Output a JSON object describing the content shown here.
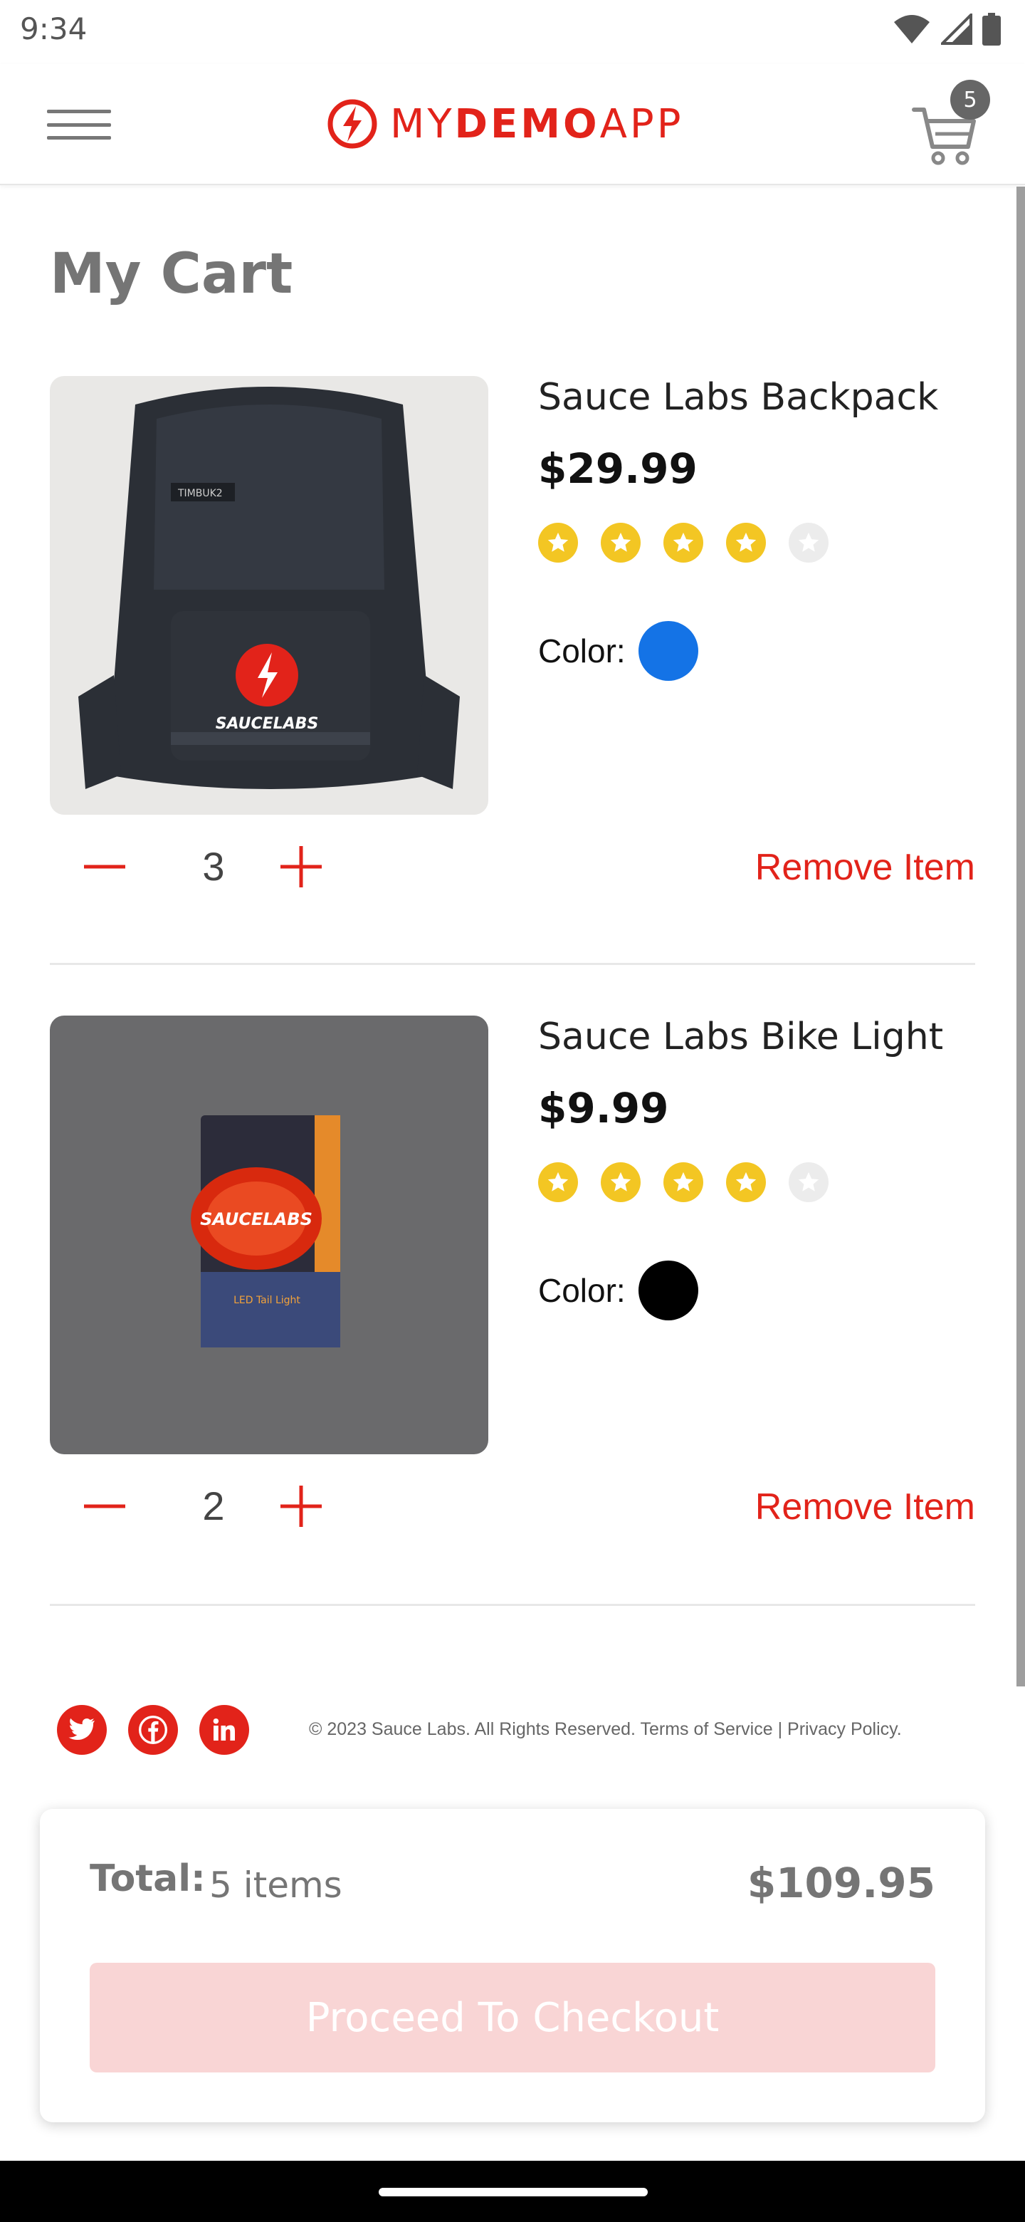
{
  "status_bar": {
    "time": "9:34"
  },
  "header": {
    "logo_text_light": "MY",
    "logo_text_bold": "DEMO",
    "logo_text_end": "APP",
    "cart_count": "5",
    "brand_color": "#e2231a"
  },
  "page_title": "My Cart",
  "products": [
    {
      "name": "Sauce Labs Backpack",
      "price": "$29.99",
      "rating": 4,
      "rating_max": 5,
      "color_label": "Color:",
      "color_value": "#1473e6",
      "quantity": "3",
      "remove_label": "Remove Item",
      "image_brand": "SAUCELABS",
      "image_tag": "TIMBUK2"
    },
    {
      "name": "Sauce Labs Bike Light",
      "price": "$9.99",
      "rating": 4,
      "rating_max": 5,
      "color_label": "Color:",
      "color_value": "#000000",
      "quantity": "2",
      "remove_label": "Remove Item",
      "image_brand": "SAUCELABS",
      "image_tag": "LED Tail Light"
    }
  ],
  "footer": {
    "copyright": "© 2023 Sauce Labs. All Rights Reserved.",
    "terms": "Terms of Service",
    "separator": "|",
    "privacy": "Privacy Policy.",
    "social": [
      "twitter-icon",
      "facebook-icon",
      "linkedin-icon"
    ]
  },
  "total": {
    "label": "Total:",
    "items": "5 items",
    "amount": "$109.95",
    "checkout_label": "Proceed To Checkout"
  }
}
